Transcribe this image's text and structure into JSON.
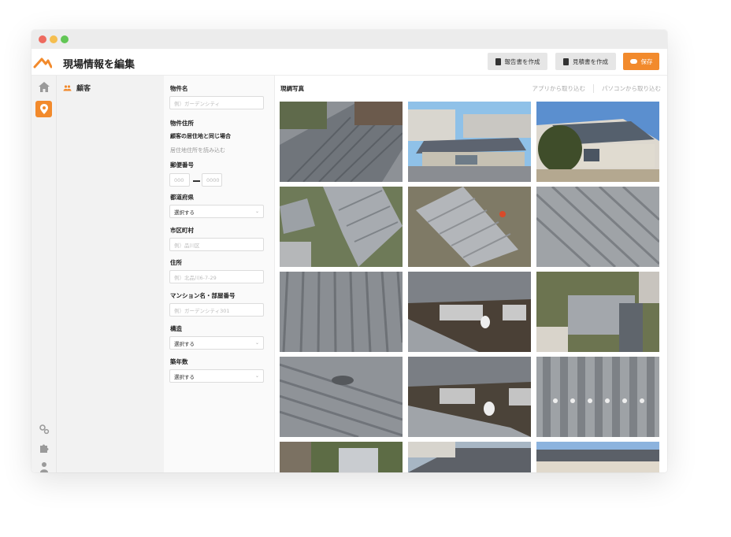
{
  "app": {
    "page_title": "現場情報を編集",
    "buttons": {
      "report": "報告書を作成",
      "estimate": "見積書を作成",
      "save": "保存"
    },
    "accent_color": "#f28a2c"
  },
  "rail": {
    "icons": [
      "home-icon",
      "location-pin-icon",
      "settings-gears-icon",
      "puzzle-icon",
      "user-icon"
    ]
  },
  "sidebar": {
    "items": [
      {
        "label": "顧客",
        "icon": "people-icon"
      }
    ]
  },
  "form": {
    "property_name": {
      "label": "物件名",
      "placeholder": "例）ガーデンシティ"
    },
    "property_address": {
      "label": "物件住所"
    },
    "same_as_customer": {
      "label": "顧客の居住地と同じ場合"
    },
    "load_address_link": "居住地住所を読み込む",
    "postal": {
      "label": "郵便番号",
      "placeholder_a": "000",
      "placeholder_b": "0000"
    },
    "prefecture": {
      "label": "都道府県",
      "value": "選択する"
    },
    "city": {
      "label": "市区町村",
      "placeholder": "例）品川区"
    },
    "address": {
      "label": "住所",
      "placeholder": "例）北品川6-7-29"
    },
    "building": {
      "label": "マンション名・部屋番号",
      "placeholder": "例）ガーデンシティ301"
    },
    "structure": {
      "label": "構造",
      "value": "選択する"
    },
    "age": {
      "label": "築年数",
      "value": "選択する"
    }
  },
  "gallery": {
    "title": "現調写真",
    "link_app": "アプリから取り込む",
    "link_pc": "パソコンから取り込む"
  }
}
